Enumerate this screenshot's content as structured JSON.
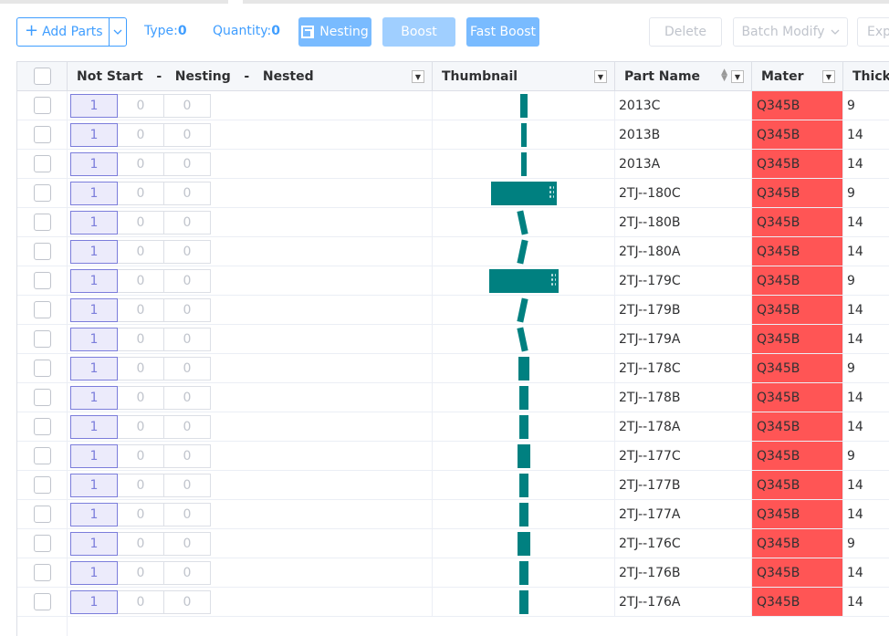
{
  "toolbar": {
    "add_parts_label": "Add Parts",
    "type_label": "Type:",
    "type_value": "0",
    "quantity_label": "Quantity:",
    "quantity_value": "0",
    "nesting_label": "Nesting",
    "boost_label": "Boost",
    "fast_boost_label": "Fast Boost",
    "delete_label": "Delete",
    "batch_modify_label": "Batch Modify",
    "export_label": "Exp"
  },
  "table": {
    "headers": {
      "status": "Not Start   -   Nesting   -   Nested",
      "thumbnail": "Thumbnail",
      "part_name": "Part Name",
      "material": "Mater",
      "thickness": "Thickr"
    },
    "rows": [
      {
        "not_start": "1",
        "nesting": "0",
        "nested": "0",
        "part_name": "2013C",
        "material": "Q345B",
        "thickness": "9",
        "shape": "thin"
      },
      {
        "not_start": "1",
        "nesting": "0",
        "nested": "0",
        "part_name": "2013B",
        "material": "Q345B",
        "thickness": "14",
        "shape": "thin2"
      },
      {
        "not_start": "1",
        "nesting": "0",
        "nested": "0",
        "part_name": "2013A",
        "material": "Q345B",
        "thickness": "14",
        "shape": "thin2"
      },
      {
        "not_start": "1",
        "nesting": "0",
        "nested": "0",
        "part_name": "2TJ--180C",
        "material": "Q345B",
        "thickness": "9",
        "shape": "wide"
      },
      {
        "not_start": "1",
        "nesting": "0",
        "nested": "0",
        "part_name": "2TJ--180B",
        "material": "Q345B",
        "thickness": "14",
        "shape": "tiltR"
      },
      {
        "not_start": "1",
        "nesting": "0",
        "nested": "0",
        "part_name": "2TJ--180A",
        "material": "Q345B",
        "thickness": "14",
        "shape": "tiltL"
      },
      {
        "not_start": "1",
        "nesting": "0",
        "nested": "0",
        "part_name": "2TJ--179C",
        "material": "Q345B",
        "thickness": "9",
        "shape": "wide2"
      },
      {
        "not_start": "1",
        "nesting": "0",
        "nested": "0",
        "part_name": "2TJ--179B",
        "material": "Q345B",
        "thickness": "14",
        "shape": "tiltL"
      },
      {
        "not_start": "1",
        "nesting": "0",
        "nested": "0",
        "part_name": "2TJ--179A",
        "material": "Q345B",
        "thickness": "14",
        "shape": "tiltR"
      },
      {
        "not_start": "1",
        "nesting": "0",
        "nested": "0",
        "part_name": "2TJ--178C",
        "material": "Q345B",
        "thickness": "9",
        "shape": "mid"
      },
      {
        "not_start": "1",
        "nesting": "0",
        "nested": "0",
        "part_name": "2TJ--178B",
        "material": "Q345B",
        "thickness": "14",
        "shape": "thin3"
      },
      {
        "not_start": "1",
        "nesting": "0",
        "nested": "0",
        "part_name": "2TJ--178A",
        "material": "Q345B",
        "thickness": "14",
        "shape": "thin3"
      },
      {
        "not_start": "1",
        "nesting": "0",
        "nested": "0",
        "part_name": "2TJ--177C",
        "material": "Q345B",
        "thickness": "9",
        "shape": "mid2"
      },
      {
        "not_start": "1",
        "nesting": "0",
        "nested": "0",
        "part_name": "2TJ--177B",
        "material": "Q345B",
        "thickness": "14",
        "shape": "thin3"
      },
      {
        "not_start": "1",
        "nesting": "0",
        "nested": "0",
        "part_name": "2TJ--177A",
        "material": "Q345B",
        "thickness": "14",
        "shape": "thin3"
      },
      {
        "not_start": "1",
        "nesting": "0",
        "nested": "0",
        "part_name": "2TJ--176C",
        "material": "Q345B",
        "thickness": "9",
        "shape": "mid2"
      },
      {
        "not_start": "1",
        "nesting": "0",
        "nested": "0",
        "part_name": "2TJ--176B",
        "material": "Q345B",
        "thickness": "14",
        "shape": "thin3"
      },
      {
        "not_start": "1",
        "nesting": "0",
        "nested": "0",
        "part_name": "2TJ--176A",
        "material": "Q345B",
        "thickness": "14",
        "shape": "thin3"
      }
    ]
  },
  "colors": {
    "accent": "#409eff",
    "material_cell": "#ff5555",
    "thumbnail_part": "#008080",
    "not_start_badge": "#ecebfb"
  }
}
